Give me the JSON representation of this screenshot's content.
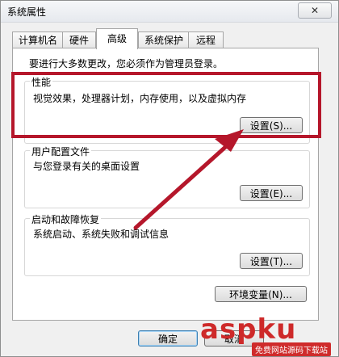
{
  "window": {
    "title": "系统属性",
    "close_label": "✕"
  },
  "tabs": [
    {
      "label": "计算机名"
    },
    {
      "label": "硬件"
    },
    {
      "label": "高级"
    },
    {
      "label": "系统保护"
    },
    {
      "label": "远程"
    }
  ],
  "active_tab": "高级",
  "notice": "要进行大多数更改，您必须作为管理员登录。",
  "groups": {
    "performance": {
      "title": "性能",
      "desc": "视觉效果，处理器计划，内存使用，以及虚拟内存",
      "button": "设置(S)..."
    },
    "user_profiles": {
      "title": "用户配置文件",
      "desc": "与您登录有关的桌面设置",
      "button": "设置(E)..."
    },
    "startup_recovery": {
      "title": "启动和故障恢复",
      "desc": "系统启动、系统失败和调试信息",
      "button": "设置(T)..."
    }
  },
  "env_button": "环境变量(N)...",
  "footer": {
    "ok": "确定",
    "cancel": "取消"
  },
  "annotation": {
    "color": "#b5172b"
  },
  "watermark": {
    "main": "aspku",
    "sub": "免费网站源码下载站"
  }
}
